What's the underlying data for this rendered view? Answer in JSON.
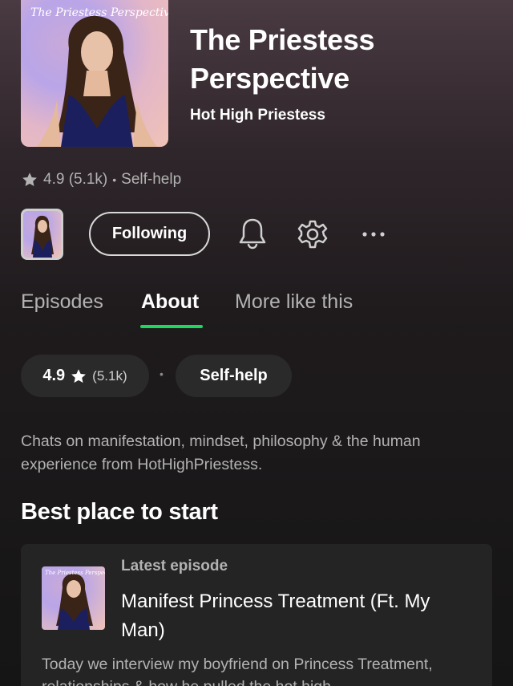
{
  "show": {
    "cover_text": "The Priestess Perspective",
    "title": "The Priestess Perspective",
    "author": "Hot High Priestess",
    "rating": "4.9",
    "rating_count": "(5.1k)",
    "category": "Self-help",
    "description": "Chats on manifestation, mindset, philosophy & the human experience from HotHighPriestess."
  },
  "rating_line": {
    "rating": "4.9 (5.1k)",
    "separator": "•",
    "category": "Self-help"
  },
  "actions": {
    "following_label": "Following",
    "icons": [
      "bell-icon",
      "gear-icon",
      "more-options-icon"
    ]
  },
  "tabs": [
    {
      "label": "Episodes",
      "active": false
    },
    {
      "label": "About",
      "active": true
    },
    {
      "label": "More like this",
      "active": false
    }
  ],
  "chips": {
    "rating": "4.9",
    "rating_count": "(5.1k)",
    "separator": "•",
    "category": "Self-help"
  },
  "section": {
    "heading": "Best place to start"
  },
  "episode_card": {
    "art_text": "The Priestess Perspective",
    "label": "Latest episode",
    "title": "Manifest Princess Treatment (Ft. My Man)",
    "description": "Today we interview my boyfriend on Princess Treatment, relationships & how he pulled the hot high"
  },
  "colors": {
    "accent": "#1ed760",
    "background": "#151515",
    "card": "#242424",
    "secondary_text": "#b3b3b3"
  }
}
